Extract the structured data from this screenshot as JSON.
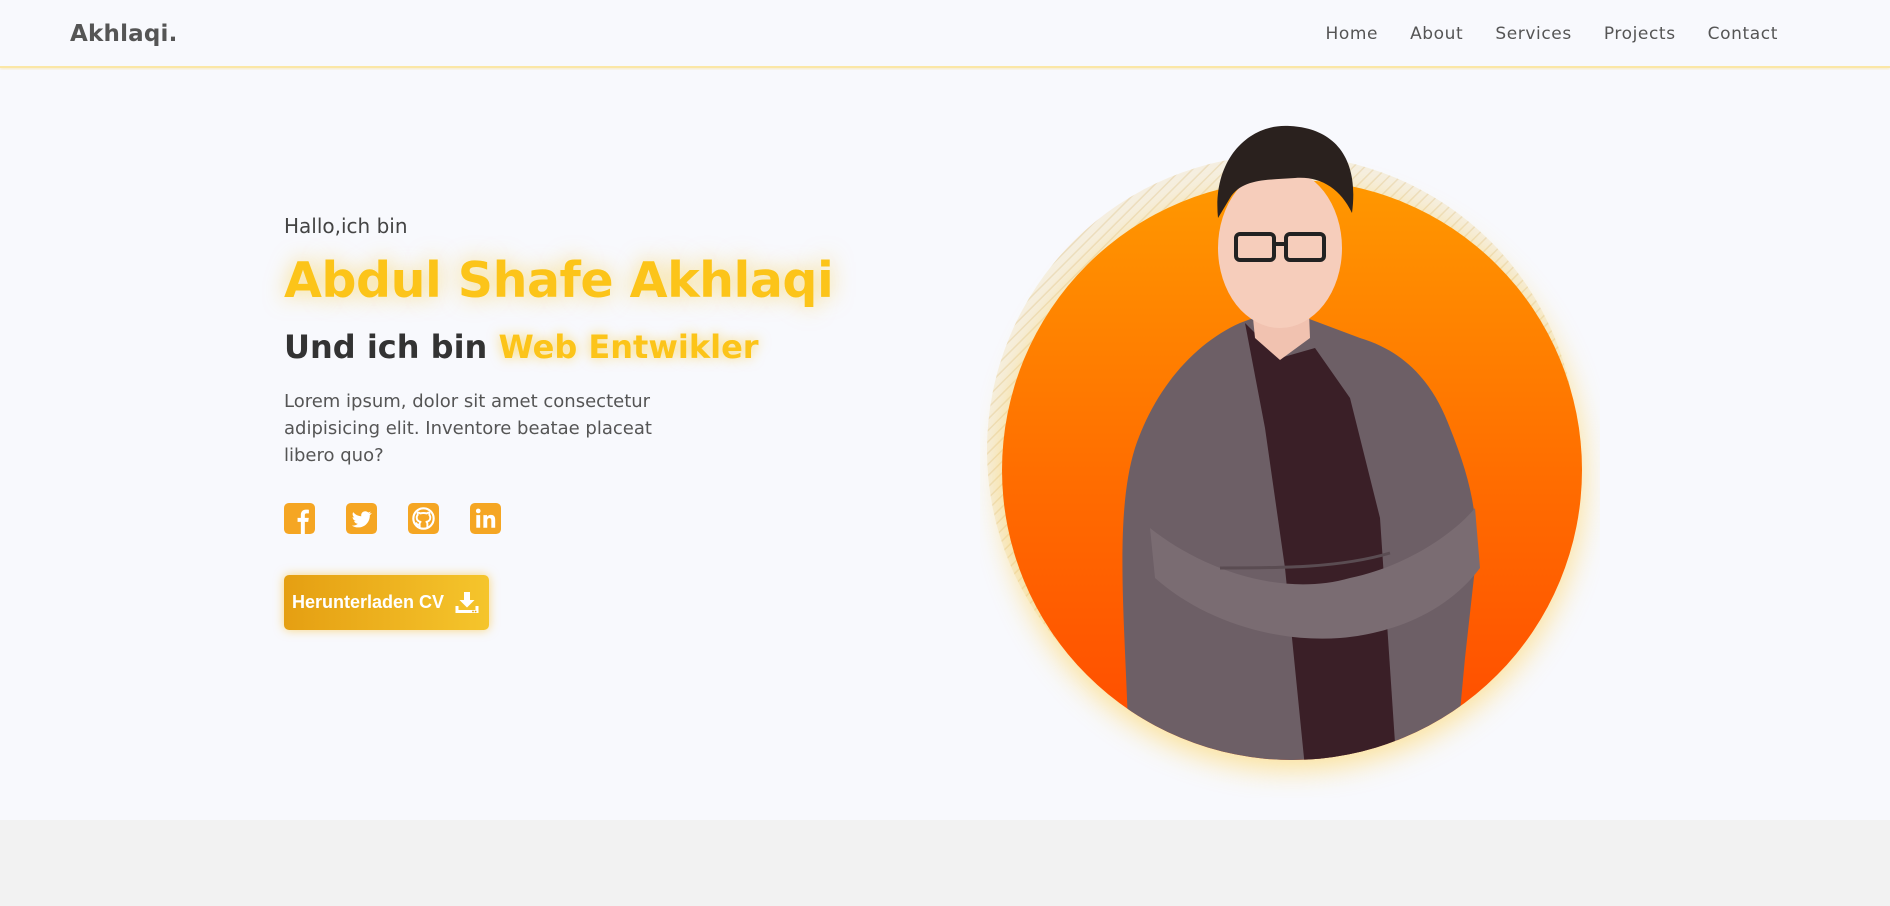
{
  "brand": {
    "logo_text": "Akhlaqi."
  },
  "nav": {
    "links": [
      "Home",
      "About",
      "Services",
      "Projects",
      "Contact"
    ]
  },
  "hero": {
    "greeting": "Hallo,ich bin",
    "name": "Abdul Shafe Akhlaqi",
    "subtitle_prefix": "Und ich bin",
    "subtitle_role": "Web Entwikler",
    "description": "Lorem ipsum, dolor sit amet consectetur adipisicing elit. Inventore beatae placeat libero quo?",
    "socials": [
      "facebook-icon",
      "twitter-icon",
      "github-icon",
      "linkedin-icon"
    ],
    "cv_button_label": "Herunterladen CV",
    "cv_button_icon": "download-icon"
  },
  "colors": {
    "accent": "#fcc419",
    "social_icon": "#f5a623",
    "circle_top": "#ff9800",
    "circle_bottom": "#ff4a00"
  }
}
